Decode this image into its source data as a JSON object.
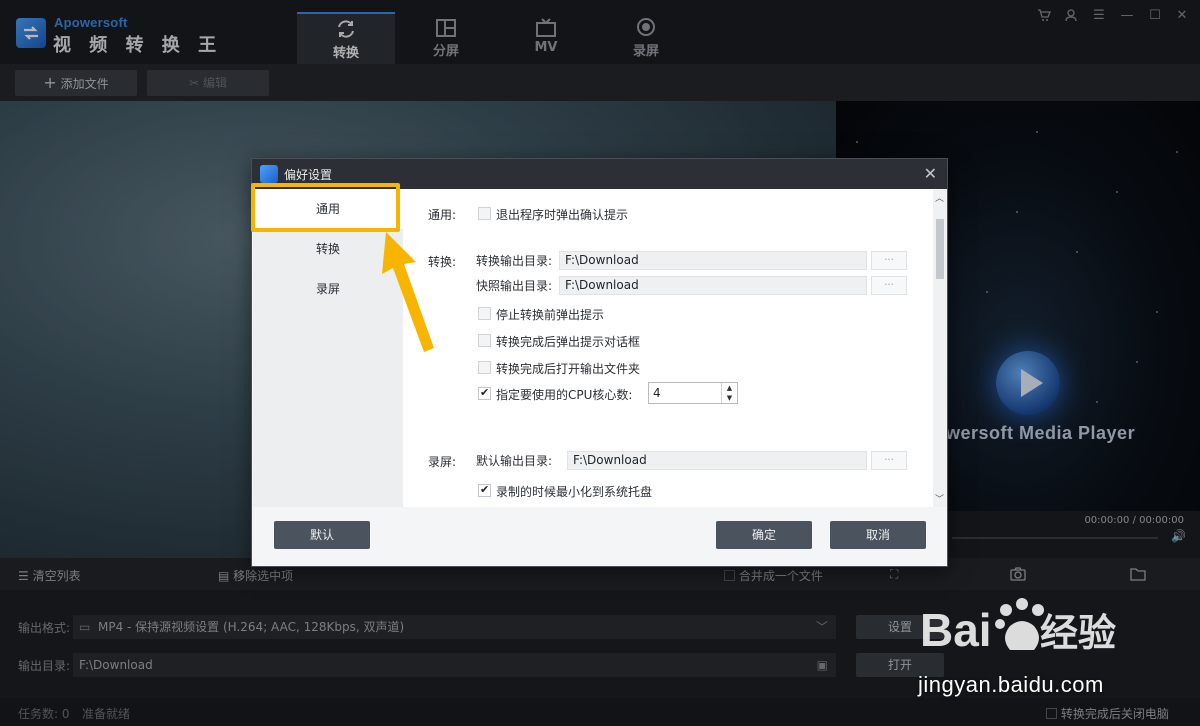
{
  "app": {
    "brand_en": "Apowersoft",
    "brand_cn": "视 频 转 换 王"
  },
  "nav": [
    {
      "label": "转换",
      "icon": "refresh-icon",
      "active": true
    },
    {
      "label": "分屏",
      "icon": "split-screen-icon"
    },
    {
      "label": "MV",
      "icon": "tv-icon"
    },
    {
      "label": "录屏",
      "icon": "record-icon"
    }
  ],
  "toolbar": {
    "add_file": "添加文件",
    "edit": "编辑"
  },
  "player": {
    "title": "wersoft Media Player",
    "time": "00:00:00 / 00:00:00"
  },
  "listbar": {
    "clear": "清空列表",
    "remove": "移除选中项",
    "merge": "合并成一个文件"
  },
  "output": {
    "format_label": "输出格式:",
    "format_value": "MP4 - 保持源视频设置 (H.264; AAC, 128Kbps, 双声道)",
    "settings_btn": "设置",
    "dir_label": "输出目录:",
    "dir_value": "F:\\Download",
    "open_btn": "打开"
  },
  "statusbar": {
    "tasks": "任务数: 0",
    "ready": "准备就绪",
    "shutdown": "转换完成后关闭电脑"
  },
  "dialog": {
    "title": "偏好设置",
    "sidebar": [
      "通用",
      "转换",
      "录屏"
    ],
    "general": {
      "label": "通用:",
      "exit_confirm": "退出程序时弹出确认提示"
    },
    "convert": {
      "label": "转换:",
      "output_dir_label": "转换输出目录:",
      "output_dir": "F:\\Download",
      "snapshot_dir_label": "快照输出目录:",
      "snapshot_dir": "F:\\Download",
      "stop_prompt": "停止转换前弹出提示",
      "done_prompt": "转换完成后弹出提示对话框",
      "open_folder": "转换完成后打开输出文件夹",
      "cpu_label": "指定要使用的CPU核心数:",
      "cpu_value": "4"
    },
    "record": {
      "label": "录屏:",
      "output_dir_label": "默认输出目录:",
      "output_dir": "F:\\Download",
      "minimize": "录制的时候最小化到系统托盘"
    },
    "browse": "···",
    "default_btn": "默认",
    "ok_btn": "确定",
    "cancel_btn": "取消"
  },
  "watermark": {
    "url": "jingyan.baidu.com"
  },
  "colors": {
    "accent": "#3d8ee8",
    "highlight": "#f7b500"
  }
}
